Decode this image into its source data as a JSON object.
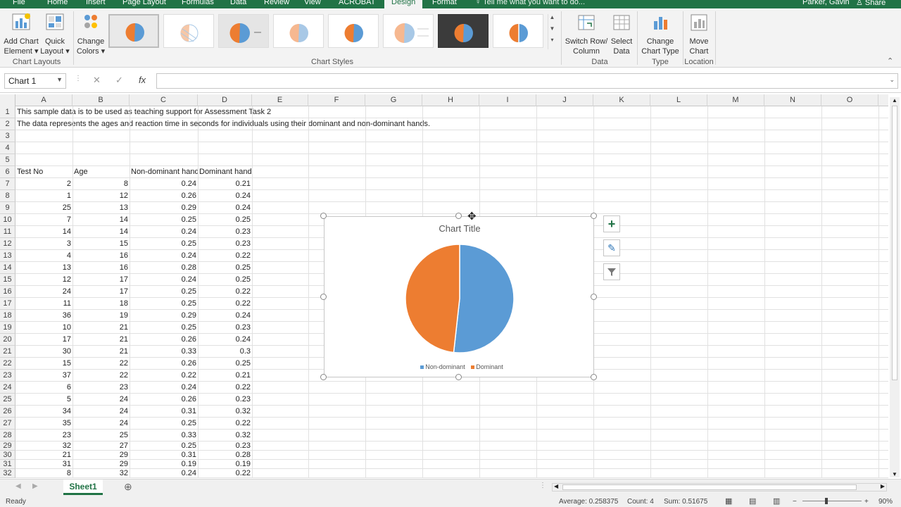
{
  "tabs": [
    "File",
    "Home",
    "Insert",
    "Page Layout",
    "Formulas",
    "Data",
    "Review",
    "View",
    "ACROBAT",
    "Design",
    "Format"
  ],
  "tell_me": "Tell me what you want to do...",
  "user": "Parker, Gavin",
  "share": "Share",
  "ribbon": {
    "add_chart_element": [
      "Add Chart",
      "Element"
    ],
    "quick_layout": [
      "Quick",
      "Layout"
    ],
    "change_colors": [
      "Change",
      "Colors"
    ],
    "chart_layouts_label": "Chart Layouts",
    "chart_styles_label": "Chart Styles",
    "switch_row_column": [
      "Switch Row/",
      "Column"
    ],
    "select_data": [
      "Select",
      "Data"
    ],
    "data_label": "Data",
    "change_chart_type": [
      "Change",
      "Chart Type"
    ],
    "type_label": "Type",
    "move_chart": [
      "Move",
      "Chart"
    ],
    "location_label": "Location"
  },
  "name_box": "Chart 1",
  "formula_value": "",
  "columns": [
    "A",
    "B",
    "C",
    "D",
    "E",
    "F",
    "G",
    "H",
    "I",
    "J",
    "K",
    "L",
    "M",
    "N",
    "O"
  ],
  "rows": [
    {
      "n": "1",
      "a": "This sample data is to be used as teaching support for Assessment Task 2"
    },
    {
      "n": "2",
      "a": "The data represents the ages and reaction time in seconds for individuals using their dominant and non-dominant hands."
    },
    {
      "n": "3"
    },
    {
      "n": "4"
    },
    {
      "n": "5"
    },
    {
      "n": "6",
      "a": "Test No",
      "b": "Age",
      "c": "Non-dominant hand",
      "d": "Dominant hand"
    },
    {
      "n": "7",
      "a": "2",
      "b": "8",
      "c": "0.24",
      "d": "0.21"
    },
    {
      "n": "8",
      "a": "1",
      "b": "12",
      "c": "0.26",
      "d": "0.24"
    },
    {
      "n": "9",
      "a": "25",
      "b": "13",
      "c": "0.29",
      "d": "0.24"
    },
    {
      "n": "10",
      "a": "7",
      "b": "14",
      "c": "0.25",
      "d": "0.25"
    },
    {
      "n": "11",
      "a": "14",
      "b": "14",
      "c": "0.24",
      "d": "0.23"
    },
    {
      "n": "12",
      "a": "3",
      "b": "15",
      "c": "0.25",
      "d": "0.23"
    },
    {
      "n": "13",
      "a": "4",
      "b": "16",
      "c": "0.24",
      "d": "0.22"
    },
    {
      "n": "14",
      "a": "13",
      "b": "16",
      "c": "0.28",
      "d": "0.25"
    },
    {
      "n": "15",
      "a": "12",
      "b": "17",
      "c": "0.24",
      "d": "0.25"
    },
    {
      "n": "16",
      "a": "24",
      "b": "17",
      "c": "0.25",
      "d": "0.22"
    },
    {
      "n": "17",
      "a": "11",
      "b": "18",
      "c": "0.25",
      "d": "0.22"
    },
    {
      "n": "18",
      "a": "36",
      "b": "19",
      "c": "0.29",
      "d": "0.24"
    },
    {
      "n": "19",
      "a": "10",
      "b": "21",
      "c": "0.25",
      "d": "0.23"
    },
    {
      "n": "20",
      "a": "17",
      "b": "21",
      "c": "0.26",
      "d": "0.24"
    },
    {
      "n": "21",
      "a": "30",
      "b": "21",
      "c": "0.33",
      "d": "0.3"
    },
    {
      "n": "22",
      "a": "15",
      "b": "22",
      "c": "0.26",
      "d": "0.25"
    },
    {
      "n": "23",
      "a": "37",
      "b": "22",
      "c": "0.22",
      "d": "0.21"
    },
    {
      "n": "24",
      "a": "6",
      "b": "23",
      "c": "0.24",
      "d": "0.22"
    },
    {
      "n": "25",
      "a": "5",
      "b": "24",
      "c": "0.26",
      "d": "0.23"
    },
    {
      "n": "26",
      "a": "34",
      "b": "24",
      "c": "0.31",
      "d": "0.32"
    },
    {
      "n": "27",
      "a": "35",
      "b": "24",
      "c": "0.25",
      "d": "0.22"
    },
    {
      "n": "28",
      "a": "23",
      "b": "25",
      "c": "0.33",
      "d": "0.32"
    },
    {
      "n": "29",
      "a": "32",
      "b": "27",
      "c": "0.25",
      "d": "0.23"
    },
    {
      "n": "30",
      "a": "21",
      "b": "29",
      "c": "0.31",
      "d": "0.28"
    },
    {
      "n": "31",
      "a": "31",
      "b": "29",
      "c": "0.19",
      "d": "0.19"
    },
    {
      "n": "32",
      "a": "8",
      "b": "32",
      "c": "0.24",
      "d": "0.22"
    }
  ],
  "chart_data": {
    "type": "pie",
    "title": "Chart Title",
    "categories": [
      "Non-dominant",
      "Dominant"
    ],
    "values": [
      0.5176,
      0.4824
    ],
    "colors": [
      "#5b9bd5",
      "#ed7d31"
    ],
    "legend": "bottom"
  },
  "sheet_tab": "Sheet1",
  "status": {
    "ready": "Ready",
    "average": "Average: 0.258375",
    "count": "Count: 4",
    "sum": "Sum: 0.51675",
    "zoom": "90%"
  }
}
